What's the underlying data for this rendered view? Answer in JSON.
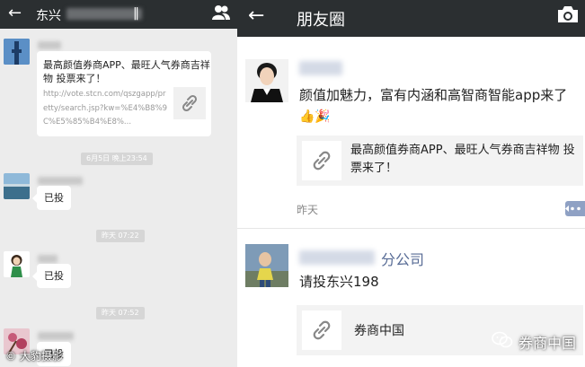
{
  "chat": {
    "header_title": "东兴",
    "header_title_suffix": "‖",
    "link_card": {
      "title": "最高颜值券商APP、最旺人气券商吉祥物 投票来了！",
      "url": "http://vote.stcn.com/qszgapp/pretty/search.jsp?kw=%E4%B8%9C%E5%85%B4%E8%..."
    },
    "times": [
      "6月5日 晚上23:54",
      "昨天 07:22",
      "昨天 07:52"
    ],
    "messages": [
      "已投",
      "已投",
      "已投"
    ]
  },
  "moments": {
    "header_title": "朋友圈",
    "post1": {
      "text": "颜值加魅力，富有内涵和高智商智能app来了",
      "emoji": "👍🎉",
      "card_title": "最高颜值券商APP、最旺人气券商吉祥物 投票来了！",
      "time": "昨天"
    },
    "post2": {
      "name_suffix": "分公司",
      "text": "请投东兴198",
      "card_title": "券商中国"
    }
  },
  "watermarks": {
    "left": "© 大豹摄影",
    "right": "券商中国"
  },
  "colors": {
    "header_bg": "#2b2f31",
    "chat_bg": "#ececec",
    "link_blue": "#576b95"
  },
  "icons": [
    "back-arrow-icon",
    "contacts-icon",
    "camera-icon",
    "link-icon",
    "more-comment-icon",
    "wechat-logo-icon"
  ]
}
